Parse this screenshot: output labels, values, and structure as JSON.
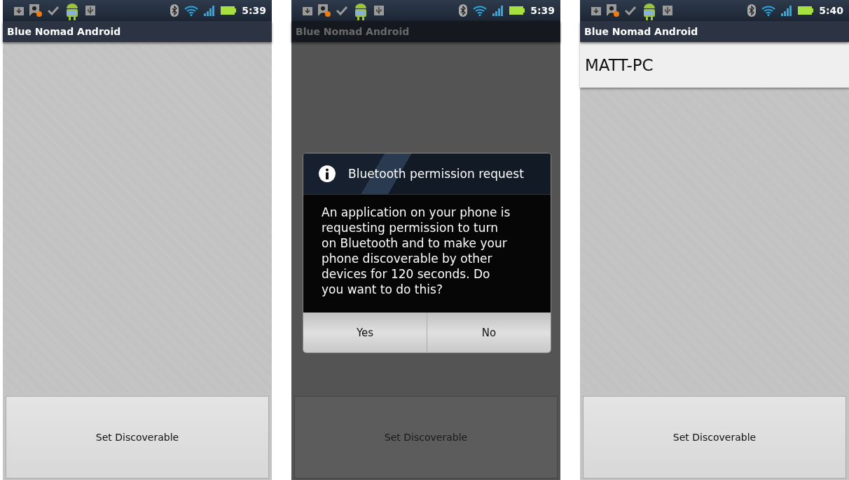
{
  "screens": [
    {
      "status_bar": {
        "time": "5:39"
      },
      "title": "Blue Nomad Android",
      "dimmed": false,
      "button": "Set Discoverable"
    },
    {
      "status_bar": {
        "time": "5:39"
      },
      "title": "Blue Nomad Android",
      "dimmed": true,
      "dialog": {
        "title": "Bluetooth permission request",
        "message": "An application on your phone is requesting permission to turn on Bluetooth and to make your phone discoverable by other devices for 120 seconds. Do you want to do this?",
        "buttons": [
          "Yes",
          "No"
        ]
      },
      "button": "Set Discoverable"
    },
    {
      "status_bar": {
        "time": "5:40"
      },
      "title": "Blue Nomad Android",
      "dimmed": false,
      "devices": [
        "MATT-PC"
      ],
      "button": "Set Discoverable"
    }
  ]
}
